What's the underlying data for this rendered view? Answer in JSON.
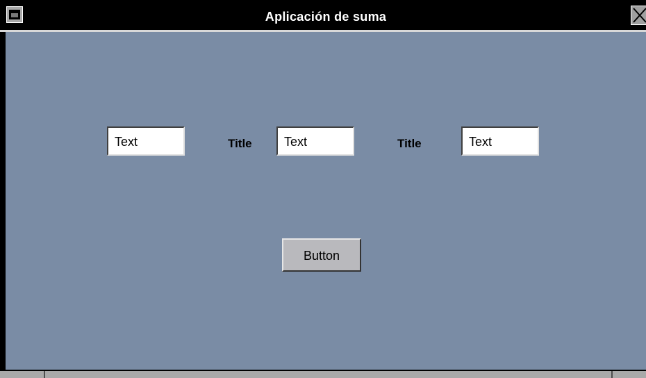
{
  "window": {
    "title": "Aplicación de suma"
  },
  "form": {
    "field1": "Text",
    "label1": "Title",
    "field2": "Text",
    "label2": "Title",
    "field3": "Text",
    "button_label": "Button"
  },
  "icons": {
    "window_menu": "window-menu-icon",
    "close": "close-icon"
  },
  "colors": {
    "background": "#7a8ca5",
    "titlebar": "#000000",
    "button": "#b9b9bd"
  }
}
